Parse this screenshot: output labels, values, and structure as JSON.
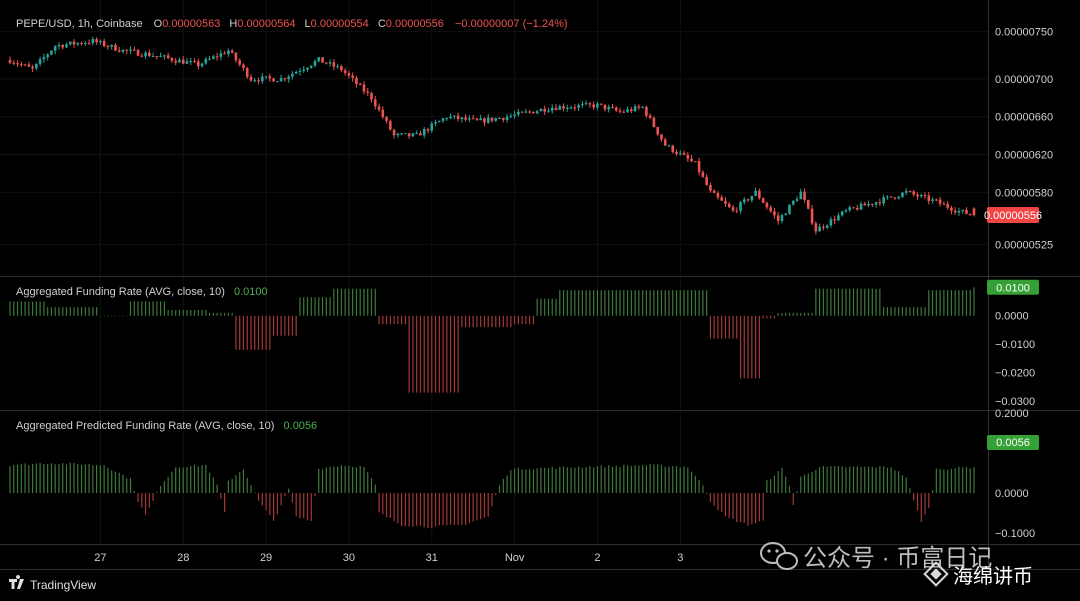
{
  "colors": {
    "up": "#26a69a",
    "down": "#ef5350",
    "up_bar": "#3e7a3a",
    "down_bar": "#a33a38",
    "text": "#c8c8c8",
    "badge_price": "#f04545",
    "badge_green": "#35a035"
  },
  "chart_data": [
    {
      "type": "candlestick",
      "symbol_line": "PEPE/USD, 1h, Coinbase",
      "ohlc": {
        "o_label": "O",
        "o": "0.00000563",
        "h_label": "H",
        "h": "0.00000564",
        "l_label": "L",
        "l": "0.00000554",
        "c_label": "C",
        "c": "0.00000556",
        "change": "−0.00000007 (−1.24%)"
      },
      "ylim": [
        5e-06,
        7.75e-06
      ],
      "ytick_values": [
        7.5e-06,
        7e-06,
        6.6e-06,
        6.2e-06,
        5.8e-06,
        5.25e-06
      ],
      "ytick_labels": [
        "0.00000750",
        "0.00000700",
        "0.00000660",
        "0.00000620",
        "0.00000580",
        "0.00000525"
      ],
      "last_price_value": 5.56e-06,
      "last_price_label": "0.00000556",
      "anchors": [
        [
          0,
          7.2e-06
        ],
        [
          6,
          7.1e-06
        ],
        [
          12,
          7.35e-06
        ],
        [
          22,
          7.4e-06
        ],
        [
          30,
          7.3e-06
        ],
        [
          38,
          7.25e-06
        ],
        [
          50,
          7.15e-06
        ],
        [
          58,
          7.3e-06
        ],
        [
          64,
          7e-06
        ],
        [
          72,
          7e-06
        ],
        [
          82,
          7.2e-06
        ],
        [
          88,
          7.1e-06
        ],
        [
          96,
          6.8e-06
        ],
        [
          102,
          6.4e-06
        ],
        [
          108,
          6.4e-06
        ],
        [
          116,
          6.6e-06
        ],
        [
          124,
          6.55e-06
        ],
        [
          132,
          6.6e-06
        ],
        [
          144,
          6.7e-06
        ],
        [
          156,
          6.72e-06
        ],
        [
          162,
          6.65e-06
        ],
        [
          168,
          6.7e-06
        ],
        [
          174,
          6.3e-06
        ],
        [
          182,
          6.1e-06
        ],
        [
          186,
          5.8e-06
        ],
        [
          192,
          5.6e-06
        ],
        [
          198,
          5.8e-06
        ],
        [
          204,
          5.5e-06
        ],
        [
          210,
          5.8e-06
        ],
        [
          214,
          5.4e-06
        ],
        [
          222,
          5.6e-06
        ],
        [
          230,
          5.7e-06
        ],
        [
          238,
          5.8e-06
        ],
        [
          246,
          5.7e-06
        ],
        [
          252,
          5.6e-06
        ],
        [
          256,
          5.56e-06
        ]
      ]
    },
    {
      "type": "bar",
      "title": "Aggregated Funding Rate (AVG, close, 10)",
      "current_value": "0.0100",
      "ylim": [
        -0.031,
        0.0115
      ],
      "ytick_values": [
        0.01,
        0.0,
        -0.01,
        -0.02,
        -0.03
      ],
      "ytick_labels": [
        "0.0100",
        "0.0000",
        "−0.0100",
        "−0.0200",
        "−0.0300"
      ],
      "segments": [
        [
          0,
          10,
          0.005
        ],
        [
          10,
          24,
          0.003
        ],
        [
          24,
          32,
          0.0
        ],
        [
          32,
          42,
          0.005
        ],
        [
          42,
          53,
          0.002
        ],
        [
          53,
          60,
          0.001
        ],
        [
          60,
          70,
          -0.012
        ],
        [
          70,
          77,
          -0.007
        ],
        [
          77,
          86,
          0.0065
        ],
        [
          86,
          98,
          0.0095
        ],
        [
          98,
          106,
          -0.003
        ],
        [
          106,
          120,
          -0.027
        ],
        [
          120,
          134,
          -0.004
        ],
        [
          134,
          140,
          -0.003
        ],
        [
          140,
          146,
          0.006
        ],
        [
          146,
          170,
          0.009
        ],
        [
          170,
          186,
          0.009
        ],
        [
          186,
          194,
          -0.008
        ],
        [
          194,
          200,
          -0.022
        ],
        [
          200,
          204,
          -0.001
        ],
        [
          204,
          214,
          0.001
        ],
        [
          214,
          232,
          0.0095
        ],
        [
          232,
          238,
          0.003
        ],
        [
          238,
          244,
          0.003
        ],
        [
          244,
          256,
          0.009
        ]
      ]
    },
    {
      "type": "bar",
      "title": "Aggregated Predicted Funding Rate (AVG, close, 10)",
      "current_value": "0.0056",
      "ylim": [
        -0.12,
        0.2
      ],
      "ytick_values": [
        0.2,
        0.0,
        -0.1
      ],
      "ytick_labels": [
        "0.2000",
        "0.0000",
        "−0.1000"
      ],
      "curve": [
        [
          0,
          0.07
        ],
        [
          10,
          0.075
        ],
        [
          25,
          0.07
        ],
        [
          32,
          0.035
        ],
        [
          34,
          -0.02
        ],
        [
          36,
          -0.055
        ],
        [
          38,
          -0.02
        ],
        [
          40,
          0.02
        ],
        [
          44,
          0.065
        ],
        [
          52,
          0.07
        ],
        [
          55,
          0.02
        ],
        [
          57,
          -0.05
        ],
        [
          58,
          0.03
        ],
        [
          62,
          0.06
        ],
        [
          66,
          -0.02
        ],
        [
          70,
          -0.07
        ],
        [
          74,
          0.01
        ],
        [
          76,
          -0.06
        ],
        [
          80,
          -0.07
        ],
        [
          82,
          0.06
        ],
        [
          88,
          0.07
        ],
        [
          94,
          0.065
        ],
        [
          97,
          0.02
        ],
        [
          98,
          -0.05
        ],
        [
          104,
          -0.08
        ],
        [
          112,
          -0.085
        ],
        [
          120,
          -0.08
        ],
        [
          127,
          -0.06
        ],
        [
          130,
          0.02
        ],
        [
          133,
          0.06
        ],
        [
          150,
          0.065
        ],
        [
          170,
          0.07
        ],
        [
          180,
          0.065
        ],
        [
          184,
          0.02
        ],
        [
          186,
          -0.02
        ],
        [
          190,
          -0.06
        ],
        [
          196,
          -0.08
        ],
        [
          200,
          -0.07
        ],
        [
          201,
          0.03
        ],
        [
          205,
          0.06
        ],
        [
          207,
          0.02
        ],
        [
          208,
          -0.03
        ],
        [
          210,
          0.04
        ],
        [
          215,
          0.065
        ],
        [
          234,
          0.065
        ],
        [
          238,
          0.04
        ],
        [
          240,
          -0.02
        ],
        [
          242,
          -0.07
        ],
        [
          244,
          -0.04
        ],
        [
          246,
          0.06
        ],
        [
          256,
          0.065
        ]
      ]
    }
  ],
  "x_axis": {
    "n_bars": 257,
    "ticks": [
      {
        "label": "27",
        "bar": 24
      },
      {
        "label": "28",
        "bar": 46
      },
      {
        "label": "29",
        "bar": 68
      },
      {
        "label": "30",
        "bar": 90
      },
      {
        "label": "31",
        "bar": 112
      },
      {
        "label": "Nov",
        "bar": 134
      },
      {
        "label": "2",
        "bar": 156
      },
      {
        "label": "3",
        "bar": 178
      }
    ]
  },
  "brand": "TradingView",
  "watermark": {
    "text1": "公众号 · 币富日记",
    "text2": "海绵讲币"
  }
}
